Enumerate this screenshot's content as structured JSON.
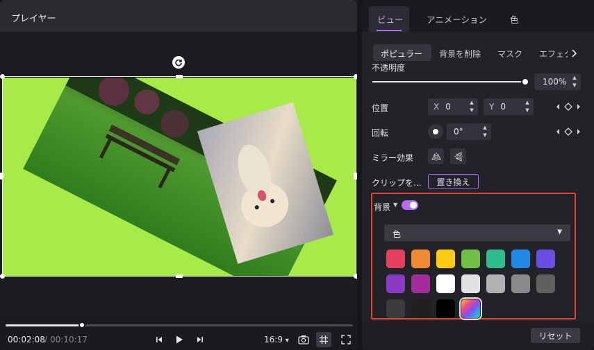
{
  "player": {
    "title": "プレイヤー",
    "time_current": "00:02:08",
    "time_separator": "/",
    "time_total": "00:10:17",
    "progress": 0.22,
    "aspect_ratio": "16:9",
    "aspect_caret": "▾"
  },
  "props": {
    "tabs": [
      {
        "label": "ビュー",
        "active": true
      },
      {
        "label": "アニメーション",
        "active": false
      },
      {
        "label": "色",
        "active": false
      }
    ],
    "subtabs": [
      {
        "label": "ポピュラー",
        "active": true
      },
      {
        "label": "背景を削除",
        "active": false
      },
      {
        "label": "マスク",
        "active": false
      },
      {
        "label": "エフェクト",
        "active": false
      }
    ],
    "opacity": {
      "label": "不透明度",
      "value_text": "100%",
      "value": 1.0
    },
    "position": {
      "label": "位置",
      "x_label": "X",
      "x_value": "0",
      "y_label": "Y",
      "y_value": "0"
    },
    "rotation": {
      "label": "回転",
      "value": "0°"
    },
    "mirror": {
      "label": "ミラー効果"
    },
    "clip": {
      "label": "クリップを...",
      "replace_button": "置き換え"
    },
    "background": {
      "label": "背景",
      "enabled": true,
      "type_value": "色",
      "swatches": [
        "#e3405e",
        "#f08a33",
        "#fccc14",
        "#72bf47",
        "#2fbd8b",
        "#2288e8",
        "#6a4ee0",
        "#8a3bc4",
        "#a32b9c",
        "#ffffff",
        "#e2e2e2",
        "#b2b2b2",
        "#8a8a8a",
        "#606060",
        "#3b3b3b",
        "#202020",
        "#000000",
        "gradient"
      ],
      "selected_swatch": 17
    },
    "reset_button": "リセット"
  },
  "colors": {
    "accent": "#b56cf5",
    "highlight_border": "#e0453a",
    "canvas_bg": "#a7ea4a"
  }
}
